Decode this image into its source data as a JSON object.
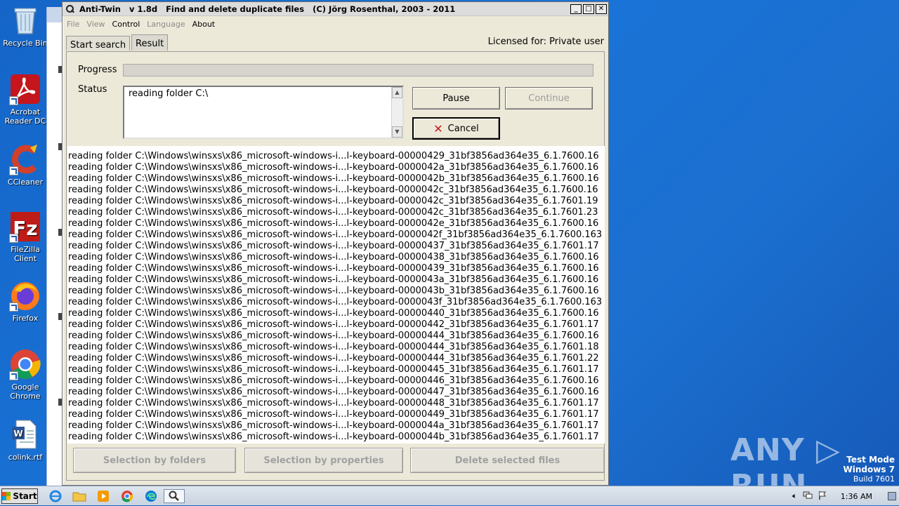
{
  "desktop": {
    "icons": [
      {
        "label": "Recycle Bin"
      },
      {
        "label": "Acrobat Reader DC"
      },
      {
        "label": "CCleaner"
      },
      {
        "label": "FileZilla Client"
      },
      {
        "label": "Firefox"
      },
      {
        "label": "Google Chrome"
      },
      {
        "label": "colink.rtf"
      }
    ]
  },
  "window": {
    "title": "Anti-Twin   v 1.8d   Find and delete duplicate files   (C) Jörg Rosenthal, 2003 - 2011",
    "controls": {
      "minimize": "_",
      "maximize": "□",
      "close": "✕"
    }
  },
  "menu": {
    "file": "File",
    "view": "View",
    "control": "Control",
    "language": "Language",
    "about": "About"
  },
  "tabs": {
    "start_search": "Start search",
    "result": "Result"
  },
  "licensed": "Licensed for: Private user",
  "progress": {
    "label": "Progress",
    "value": 0
  },
  "status": {
    "label": "Status",
    "text": "reading folder C:\\"
  },
  "buttons": {
    "pause": "Pause",
    "continue": "Continue",
    "cancel": "Cancel",
    "selection_by_folders": "Selection by folders",
    "selection_by_properties": "Selection by properties",
    "delete_selected_files": "Delete selected files"
  },
  "log": [
    "reading folder C:\\Windows\\winsxs\\x86_microsoft-windows-i...l-keyboard-00000429_31bf3856ad364e35_6.1.7600.16",
    "reading folder C:\\Windows\\winsxs\\x86_microsoft-windows-i...l-keyboard-0000042a_31bf3856ad364e35_6.1.7600.16",
    "reading folder C:\\Windows\\winsxs\\x86_microsoft-windows-i...l-keyboard-0000042b_31bf3856ad364e35_6.1.7600.16",
    "reading folder C:\\Windows\\winsxs\\x86_microsoft-windows-i...l-keyboard-0000042c_31bf3856ad364e35_6.1.7600.16",
    "reading folder C:\\Windows\\winsxs\\x86_microsoft-windows-i...l-keyboard-0000042c_31bf3856ad364e35_6.1.7601.19",
    "reading folder C:\\Windows\\winsxs\\x86_microsoft-windows-i...l-keyboard-0000042c_31bf3856ad364e35_6.1.7601.23",
    "reading folder C:\\Windows\\winsxs\\x86_microsoft-windows-i...l-keyboard-0000042e_31bf3856ad364e35_6.1.7600.16",
    "reading folder C:\\Windows\\winsxs\\x86_microsoft-windows-i...l-keyboard-0000042f_31bf3856ad364e35_6.1.7600.163",
    "reading folder C:\\Windows\\winsxs\\x86_microsoft-windows-i...l-keyboard-00000437_31bf3856ad364e35_6.1.7601.17",
    "reading folder C:\\Windows\\winsxs\\x86_microsoft-windows-i...l-keyboard-00000438_31bf3856ad364e35_6.1.7600.16",
    "reading folder C:\\Windows\\winsxs\\x86_microsoft-windows-i...l-keyboard-00000439_31bf3856ad364e35_6.1.7600.16",
    "reading folder C:\\Windows\\winsxs\\x86_microsoft-windows-i...l-keyboard-0000043a_31bf3856ad364e35_6.1.7600.16",
    "reading folder C:\\Windows\\winsxs\\x86_microsoft-windows-i...l-keyboard-0000043b_31bf3856ad364e35_6.1.7600.16",
    "reading folder C:\\Windows\\winsxs\\x86_microsoft-windows-i...l-keyboard-0000043f_31bf3856ad364e35_6.1.7600.163",
    "reading folder C:\\Windows\\winsxs\\x86_microsoft-windows-i...l-keyboard-00000440_31bf3856ad364e35_6.1.7600.16",
    "reading folder C:\\Windows\\winsxs\\x86_microsoft-windows-i...l-keyboard-00000442_31bf3856ad364e35_6.1.7601.17",
    "reading folder C:\\Windows\\winsxs\\x86_microsoft-windows-i...l-keyboard-00000444_31bf3856ad364e35_6.1.7600.16",
    "reading folder C:\\Windows\\winsxs\\x86_microsoft-windows-i...l-keyboard-00000444_31bf3856ad364e35_6.1.7601.18",
    "reading folder C:\\Windows\\winsxs\\x86_microsoft-windows-i...l-keyboard-00000444_31bf3856ad364e35_6.1.7601.22",
    "reading folder C:\\Windows\\winsxs\\x86_microsoft-windows-i...l-keyboard-00000445_31bf3856ad364e35_6.1.7601.17",
    "reading folder C:\\Windows\\winsxs\\x86_microsoft-windows-i...l-keyboard-00000446_31bf3856ad364e35_6.1.7600.16",
    "reading folder C:\\Windows\\winsxs\\x86_microsoft-windows-i...l-keyboard-00000447_31bf3856ad364e35_6.1.7600.16",
    "reading folder C:\\Windows\\winsxs\\x86_microsoft-windows-i...l-keyboard-00000448_31bf3856ad364e35_6.1.7601.17",
    "reading folder C:\\Windows\\winsxs\\x86_microsoft-windows-i...l-keyboard-00000449_31bf3856ad364e35_6.1.7601.17",
    "reading folder C:\\Windows\\winsxs\\x86_microsoft-windows-i...l-keyboard-0000044a_31bf3856ad364e35_6.1.7601.17",
    "reading folder C:\\Windows\\winsxs\\x86_microsoft-windows-i...l-keyboard-0000044b_31bf3856ad364e35_6.1.7601.17"
  ],
  "watermark": "ANY ▷ RUN",
  "os_info": {
    "line1": "Test Mode",
    "line2": "Windows 7",
    "line3": "Build 7601"
  },
  "taskbar": {
    "start": "Start",
    "clock": "1:36 AM"
  },
  "colors": {
    "desktop": "#1a73d6",
    "window_bg": "#ece9d8",
    "cancel_x": "#c8161d"
  }
}
